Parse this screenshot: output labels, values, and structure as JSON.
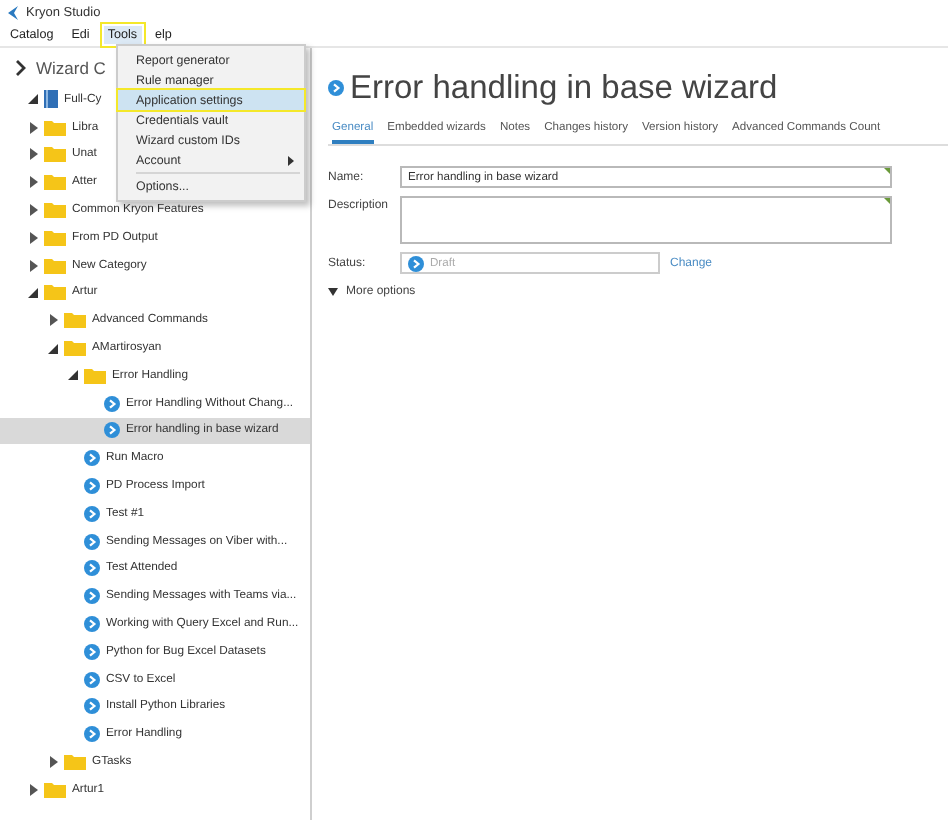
{
  "window": {
    "title": "Kryon Studio"
  },
  "menu_bar": [
    {
      "label": "Catalog",
      "selected": false
    },
    {
      "label": "Edi",
      "selected": false
    },
    {
      "label": "Tools",
      "selected": true
    },
    {
      "label": "elp",
      "selected": false
    }
  ],
  "tools_menu": {
    "items": [
      {
        "label": "Report generator",
        "kind": "item",
        "selected": false
      },
      {
        "label": "Rule manager",
        "kind": "item",
        "selected": false
      },
      {
        "label": "Application settings",
        "kind": "item",
        "selected": true
      },
      {
        "label": "Credentials vault",
        "kind": "item",
        "selected": false
      },
      {
        "label": "Wizard custom IDs",
        "kind": "item",
        "selected": false
      },
      {
        "label": "Account",
        "kind": "submenu",
        "selected": false
      },
      {
        "label": "Options...",
        "kind": "item",
        "selected": false
      }
    ]
  },
  "sidebar": {
    "header": "Wizard C",
    "tree": [
      {
        "label": "Full-Cy",
        "kind": "catalog",
        "expanded": true,
        "selected": false,
        "children": [
          {
            "label": "Libra",
            "kind": "folder",
            "expanded": false,
            "selected": false
          },
          {
            "label": "Unat",
            "kind": "folder",
            "expanded": false,
            "selected": false
          },
          {
            "label": "Atter",
            "kind": "folder",
            "expanded": false,
            "selected": false
          },
          {
            "label": "Common Kryon Features",
            "kind": "folder",
            "expanded": false,
            "selected": false
          },
          {
            "label": "From PD Output",
            "kind": "folder",
            "expanded": false,
            "selected": false
          },
          {
            "label": "New Category",
            "kind": "folder",
            "expanded": false,
            "selected": false
          },
          {
            "label": "Artur",
            "kind": "folder",
            "expanded": true,
            "selected": false,
            "children": [
              {
                "label": "Advanced Commands",
                "kind": "folder",
                "expanded": false,
                "selected": false
              },
              {
                "label": "AMartirosyan",
                "kind": "folder",
                "expanded": true,
                "selected": false,
                "children": [
                  {
                    "label": "Error Handling",
                    "kind": "folder",
                    "expanded": true,
                    "selected": false,
                    "children": [
                      {
                        "label": "Error Handling Without Chang...",
                        "kind": "wizard",
                        "selected": false
                      },
                      {
                        "label": "Error handling in base wizard",
                        "kind": "wizard",
                        "selected": true
                      }
                    ]
                  },
                  {
                    "label": "Run Macro",
                    "kind": "wizard",
                    "selected": false
                  },
                  {
                    "label": "PD Process Import",
                    "kind": "wizard",
                    "selected": false
                  },
                  {
                    "label": "Test #1",
                    "kind": "wizard",
                    "selected": false
                  },
                  {
                    "label": "Sending Messages on Viber with...",
                    "kind": "wizard",
                    "selected": false
                  },
                  {
                    "label": "Test Attended",
                    "kind": "wizard",
                    "selected": false
                  },
                  {
                    "label": "Sending Messages with Teams via...",
                    "kind": "wizard",
                    "selected": false
                  },
                  {
                    "label": "Working with Query Excel and Run...",
                    "kind": "wizard",
                    "selected": false
                  },
                  {
                    "label": "Python for Bug Excel Datasets",
                    "kind": "wizard",
                    "selected": false
                  },
                  {
                    "label": "CSV to Excel",
                    "kind": "wizard",
                    "selected": false
                  },
                  {
                    "label": "Install Python Libraries",
                    "kind": "wizard",
                    "selected": false
                  },
                  {
                    "label": "Error Handling",
                    "kind": "wizard",
                    "selected": false
                  }
                ]
              },
              {
                "label": "GTasks",
                "kind": "folder",
                "expanded": false,
                "selected": false
              }
            ]
          },
          {
            "label": "Artur1",
            "kind": "folder",
            "expanded": false,
            "selected": false
          }
        ]
      }
    ]
  },
  "detail": {
    "title": "Error handling in base wizard",
    "tabs": [
      {
        "label": "General",
        "selected": true
      },
      {
        "label": "Embedded wizards",
        "selected": false
      },
      {
        "label": "Notes",
        "selected": false
      },
      {
        "label": "Changes history",
        "selected": false
      },
      {
        "label": "Version history",
        "selected": false
      },
      {
        "label": "Advanced Commands Count",
        "selected": false
      }
    ],
    "name_label": "Name:",
    "name_value": "Error handling in base wizard",
    "description_label": "Description",
    "status_label": "Status:",
    "status_placeholder": "Draft",
    "change_link": "Change",
    "more_options": "More options"
  }
}
